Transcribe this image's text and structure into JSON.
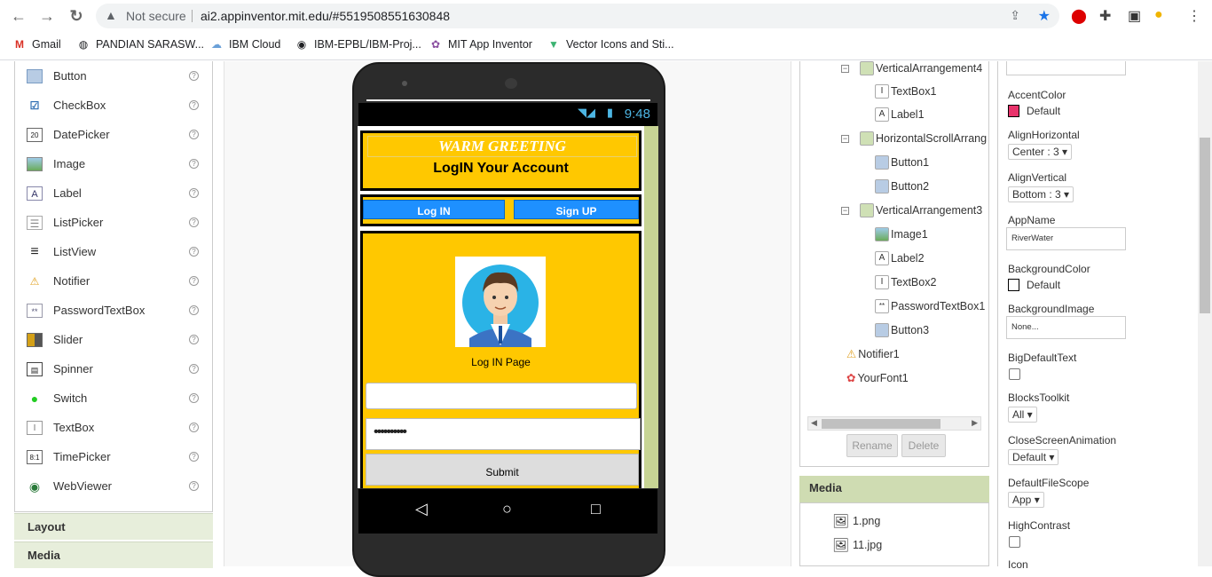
{
  "browser": {
    "not_secure": "Not secure",
    "url": "ai2.appinventor.mit.edu/#5519508551630848",
    "bookmarks": [
      "Gmail",
      "PANDIAN SARASW...",
      "IBM Cloud",
      "IBM-EPBL/IBM-Proj...",
      "MIT App Inventor",
      "Vector Icons and Sti..."
    ]
  },
  "palette": {
    "items": [
      "Button",
      "CheckBox",
      "DatePicker",
      "Image",
      "Label",
      "ListPicker",
      "ListView",
      "Notifier",
      "PasswordTextBox",
      "Slider",
      "Spinner",
      "Switch",
      "TextBox",
      "TimePicker",
      "WebViewer"
    ],
    "help": "?",
    "sections": [
      "Layout",
      "Media"
    ]
  },
  "phone": {
    "time": "9:48",
    "greeting": "WARM GREETING",
    "login_account": "LogIN Your Account",
    "login_button": "Log IN",
    "signup_button": "Sign UP",
    "login_page_label": "Log IN Page",
    "password_dots": "••••••••••",
    "submit": "Submit"
  },
  "tree": {
    "nodes": [
      "VerticalArrangement4",
      "TextBox1",
      "Label1",
      "HorizontalScrollArrang",
      "Button1",
      "Button2",
      "VerticalArrangement3",
      "Image1",
      "Label2",
      "TextBox2",
      "PasswordTextBox1",
      "Button3",
      "Notifier1",
      "YourFont1"
    ],
    "rename": "Rename",
    "delete": "Delete"
  },
  "media": {
    "title": "Media",
    "files": [
      "1.png",
      "11.jpg"
    ]
  },
  "properties": {
    "accent_color_label": "AccentColor",
    "accent_color_value": "Default",
    "accent_color": "#e8336b",
    "align_h_label": "AlignHorizontal",
    "align_h_value": "Center : 3",
    "align_v_label": "AlignVertical",
    "align_v_value": "Bottom : 3",
    "appname_label": "AppName",
    "appname_value": "RiverWater",
    "bgcolor_label": "BackgroundColor",
    "bgcolor_value": "Default",
    "bgimage_label": "BackgroundImage",
    "bgimage_value": "None...",
    "bigtext_label": "BigDefaultText",
    "blocks_label": "BlocksToolkit",
    "blocks_value": "All",
    "close_anim_label": "CloseScreenAnimation",
    "close_anim_value": "Default",
    "filescope_label": "DefaultFileScope",
    "filescope_value": "App",
    "highcontrast_label": "HighContrast",
    "icon_label": "Icon"
  }
}
